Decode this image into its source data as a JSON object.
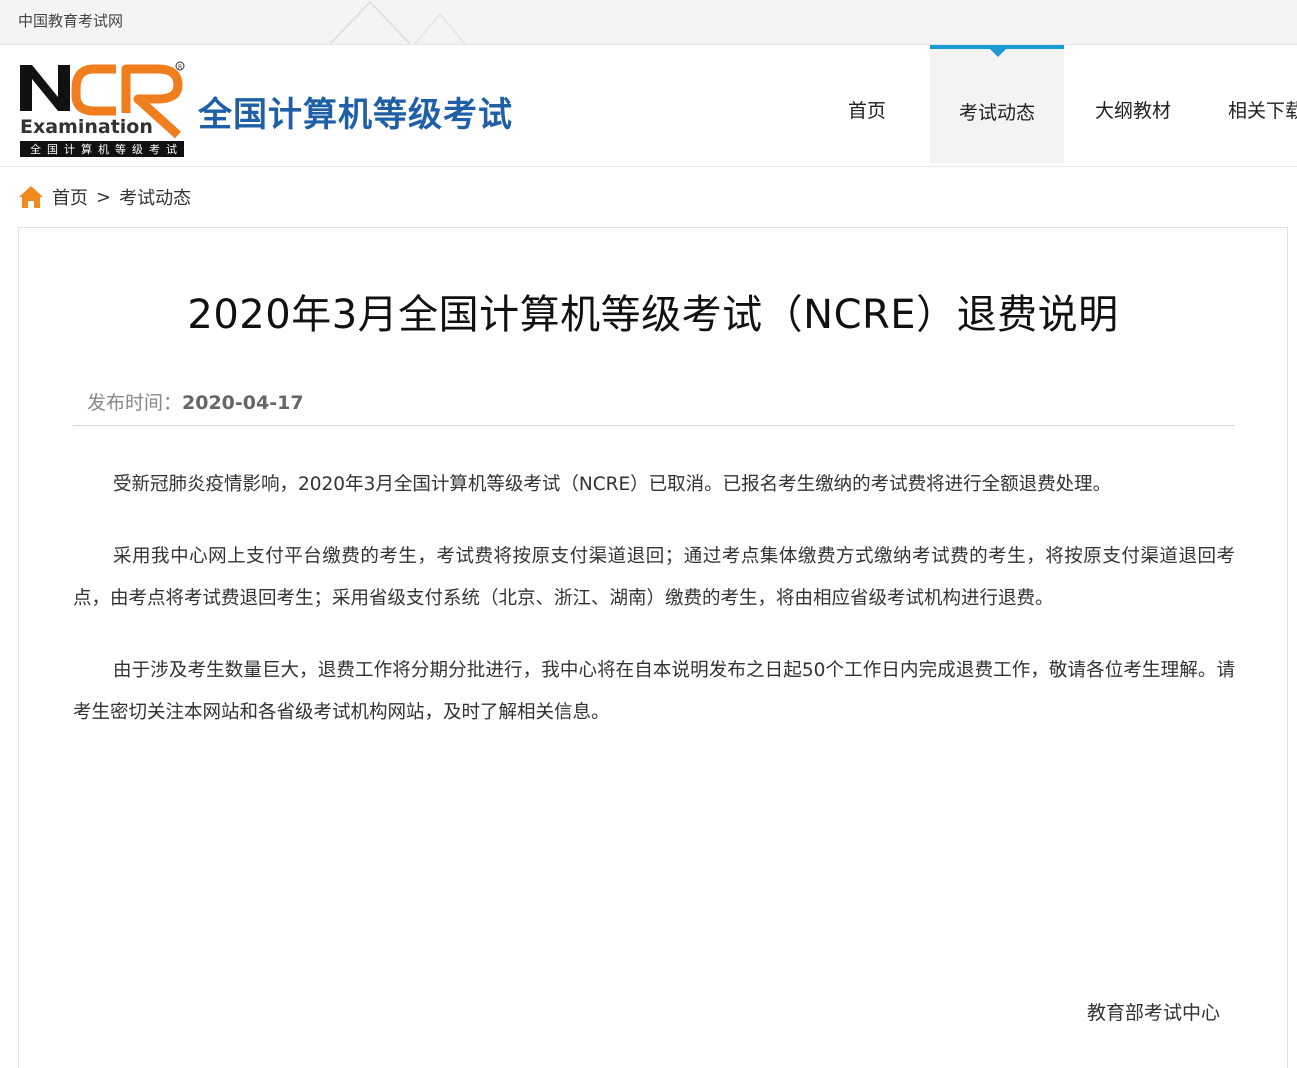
{
  "topbar": {
    "site_link": "中国教育考试网"
  },
  "header": {
    "logo_icon": "ncre-logo",
    "logo_text": "Examination",
    "logo_subtext": "全国计算机等级考试",
    "site_title": "全国计算机等级考试",
    "nav": [
      {
        "label": "首页"
      },
      {
        "label": "考试动态",
        "active": true
      },
      {
        "label": "大纲教材"
      },
      {
        "label": "相关下载"
      }
    ]
  },
  "breadcrumb": {
    "home_icon": "home-icon",
    "home": "首页",
    "separator": ">",
    "current": "考试动态"
  },
  "article": {
    "title": "2020年3月全国计算机等级考试（NCRE）退费说明",
    "meta_label": "发布时间：",
    "meta_date": "2020-04-17",
    "paragraphs": [
      "受新冠肺炎疫情影响，2020年3月全国计算机等级考试（NCRE）已取消。已报名考生缴纳的考试费将进行全额退费处理。",
      "采用我中心网上支付平台缴费的考生，考试费将按原支付渠道退回；通过考点集体缴费方式缴纳考试费的考生，将按原支付渠道退回考点，由考点将考试费退回考生；采用省级支付系统（北京、浙江、湖南）缴费的考生，将由相应省级考试机构进行退费。",
      "由于涉及考生数量巨大，退费工作将分期分批进行，我中心将在自本说明发布之日起50个工作日内完成退费工作，敬请各位考生理解。请考生密切关注本网站和各省级考试机构网站，及时了解相关信息。"
    ],
    "signature": "教育部考试中心"
  },
  "colors": {
    "brand_blue": "#1e5fa8",
    "nav_accent": "#1c9ad6",
    "logo_orange": "#f07d1e",
    "home_icon_orange": "#f08a1c"
  }
}
